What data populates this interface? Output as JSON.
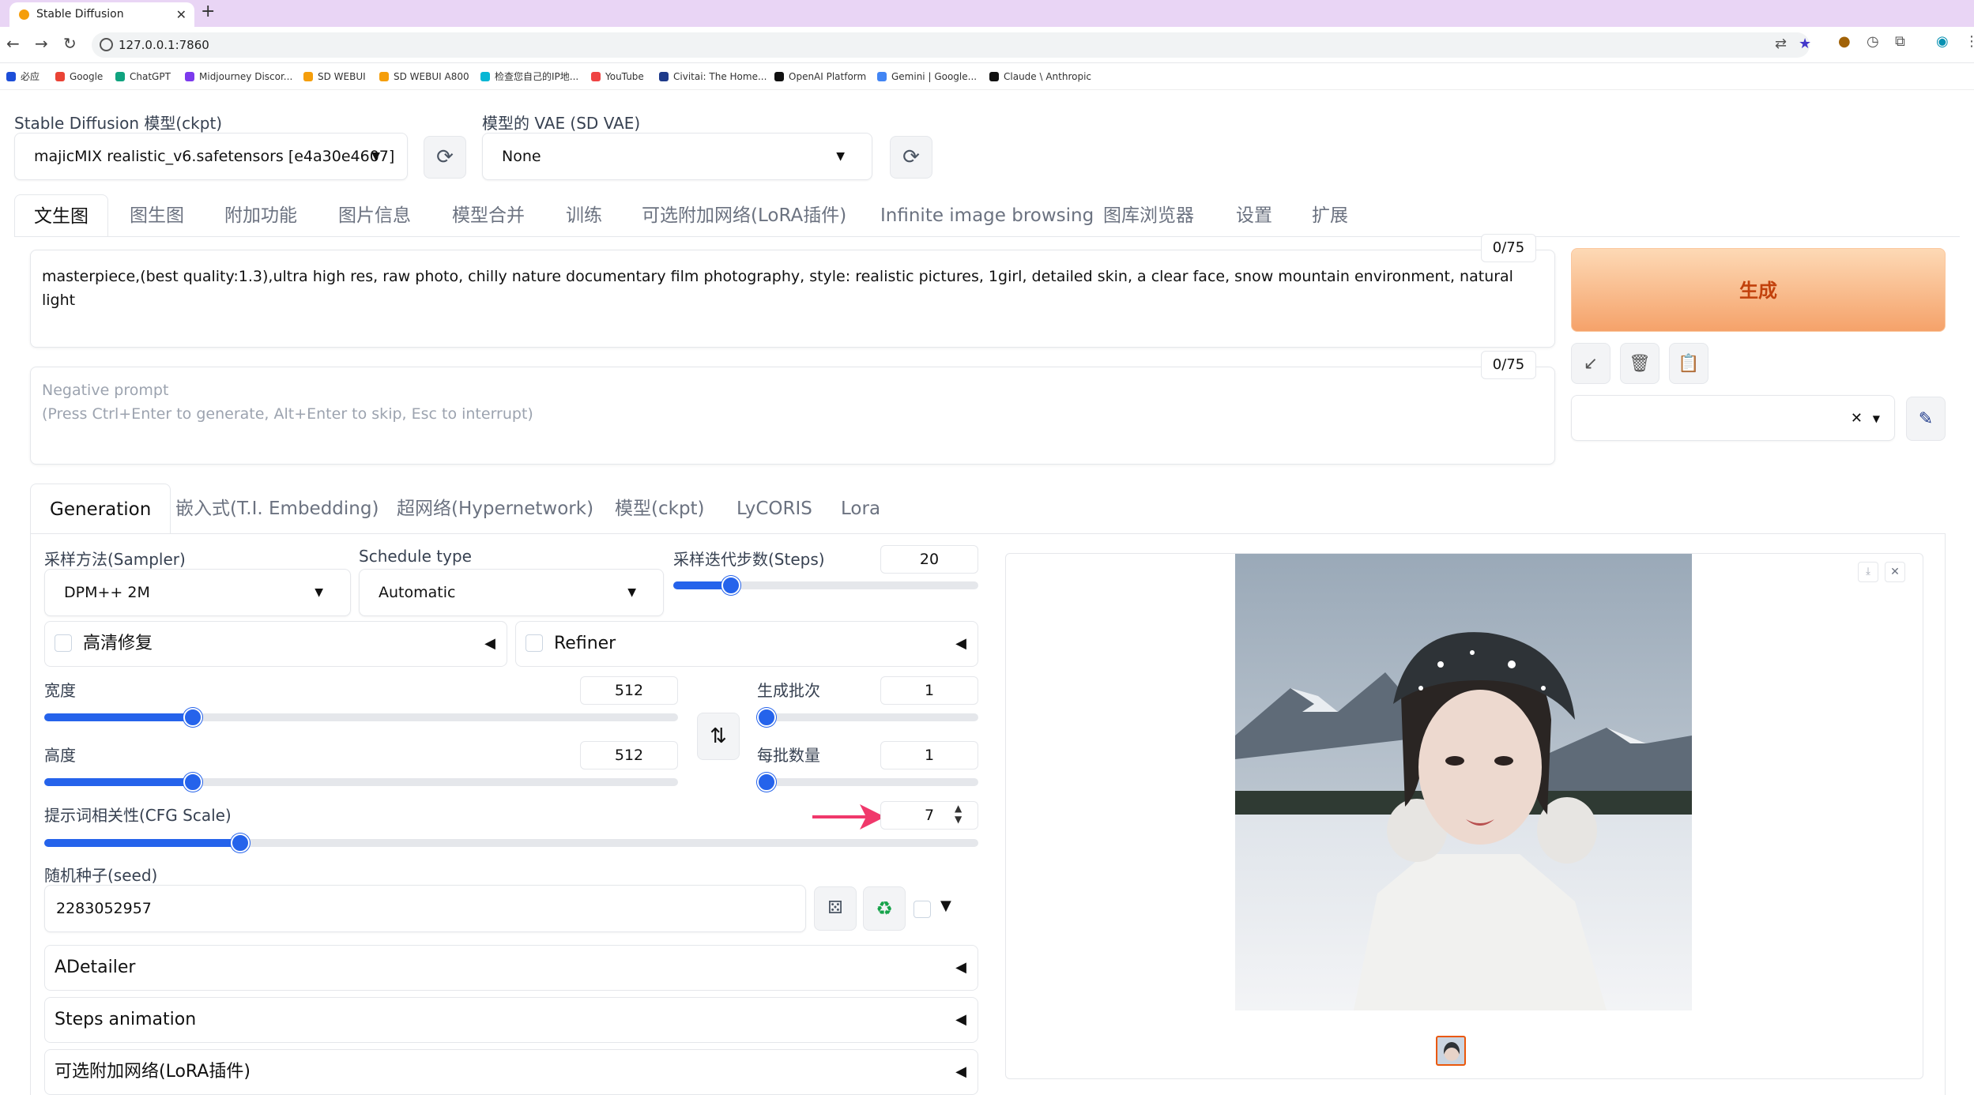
{
  "browser": {
    "tab_title": "Stable Diffusion",
    "url": "127.0.0.1:7860",
    "bookmarks": [
      "必应",
      "Google",
      "ChatGPT",
      "Midjourney Discor...",
      "SD WEBUI",
      "SD WEBUI A800",
      "检查您自己的IP地...",
      "YouTube",
      "Civitai: The Home...",
      "OpenAI Platform",
      "Gemini | Google...",
      "Claude \\ Anthropic"
    ]
  },
  "header": {
    "checkpoint_label": "Stable Diffusion 模型(ckpt)",
    "checkpoint_value": "majicMIX realistic_v6.safetensors [e4a30e4607]",
    "vae_label": "模型的 VAE (SD VAE)",
    "vae_value": "None"
  },
  "main_tabs": [
    "文生图",
    "图生图",
    "附加功能",
    "图片信息",
    "模型合并",
    "训练",
    "可选附加网络(LoRA插件)",
    "Infinite image browsing",
    "图库浏览器",
    "设置",
    "扩展"
  ],
  "prompt": {
    "text": "masterpiece,(best quality:1.3),ultra high res, raw photo, chilly nature documentary film photography, style: realistic pictures, 1girl, detailed skin, a clear face, snow mountain environment, natural light",
    "counter": "0/75",
    "negative_placeholder_line1": "Negative prompt",
    "negative_placeholder_line2": "(Press Ctrl+Enter to generate, Alt+Enter to skip, Esc to interrupt)",
    "negative_counter": "0/75"
  },
  "generate_label": "生成",
  "sub_tabs": [
    "Generation",
    "嵌入式(T.I. Embedding)",
    "超网络(Hypernetwork)",
    "模型(ckpt)",
    "LyCORIS",
    "Lora"
  ],
  "generation": {
    "sampler_label": "采样方法(Sampler)",
    "sampler_value": "DPM++ 2M",
    "schedule_label": "Schedule type",
    "schedule_value": "Automatic",
    "steps_label": "采样迭代步数(Steps)",
    "steps_value": "20",
    "steps_fraction": 0.19,
    "hires_label": "高清修复",
    "refiner_label": "Refiner",
    "width_label": "宽度",
    "width_value": "512",
    "width_fraction": 0.234,
    "height_label": "高度",
    "height_value": "512",
    "height_fraction": 0.234,
    "batch_count_label": "生成批次",
    "batch_count_value": "1",
    "batch_count_fraction": 0.0,
    "batch_size_label": "每批数量",
    "batch_size_value": "1",
    "batch_size_fraction": 0.0,
    "cfg_label": "提示词相关性(CFG Scale)",
    "cfg_value": "7",
    "cfg_fraction": 0.21,
    "seed_label": "随机种子(seed)",
    "seed_value": "2283052957",
    "accordions": [
      "ADetailer",
      "Steps animation",
      "可选附加网络(LoRA插件)"
    ]
  },
  "colors": {
    "accent": "#2563eb",
    "generate_from": "#fdd9b5",
    "generate_to": "#f5a26a",
    "arrow": "#f0386b"
  }
}
